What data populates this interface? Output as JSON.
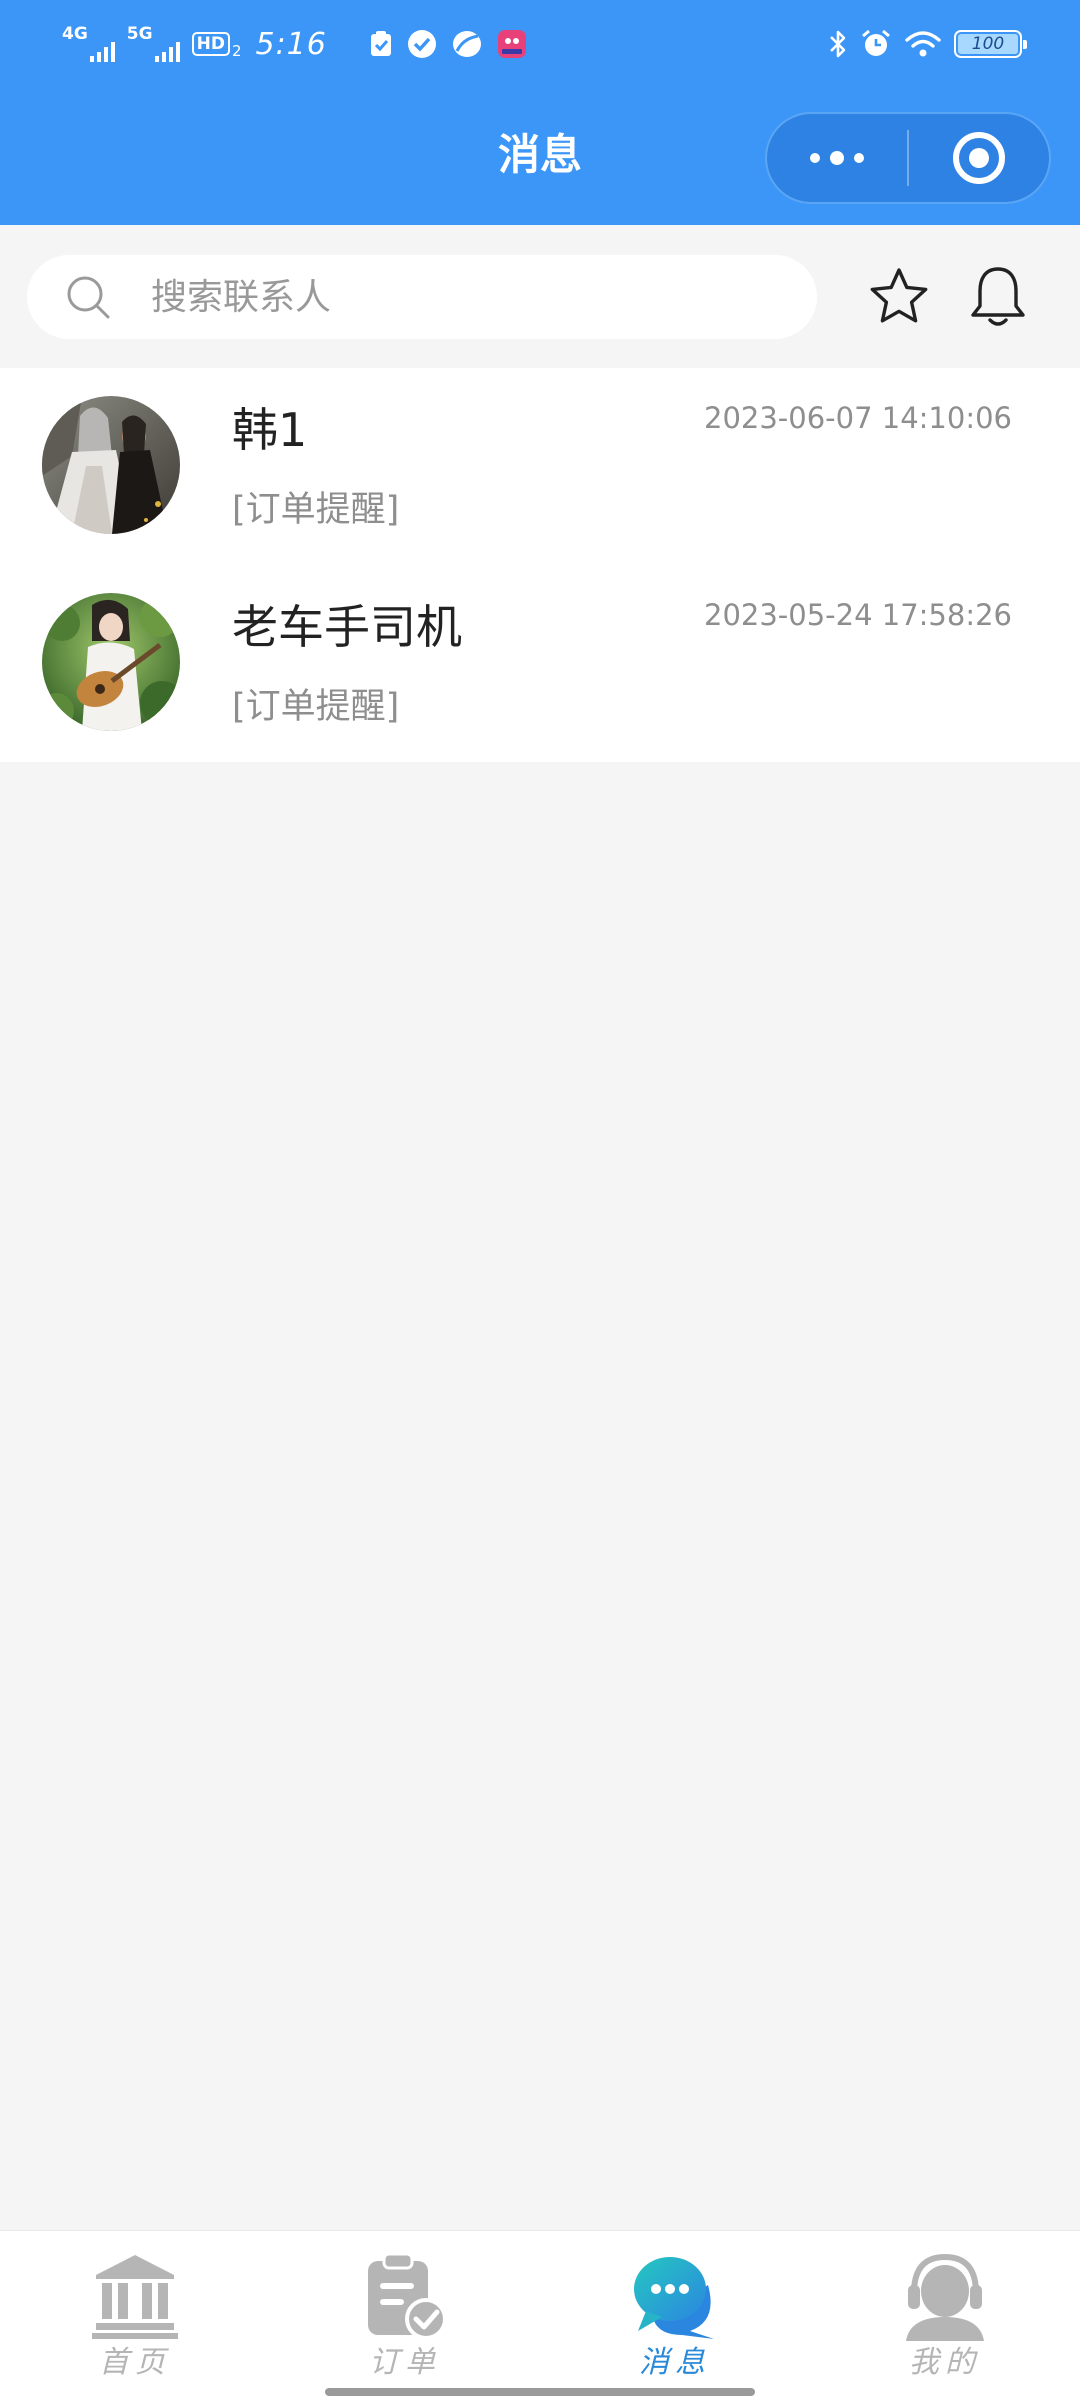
{
  "status_bar": {
    "network_1": "4G",
    "network_2": "5G",
    "hd_label": "HD",
    "hd_sub": "2",
    "time": "5:16",
    "battery_level": "100",
    "battery_fraction": 1.0
  },
  "header": {
    "title": "消息",
    "menu_icon": "more-dots-icon",
    "close_icon": "target-circle-icon",
    "background_color": "#3b96f7"
  },
  "search": {
    "placeholder": "搜索联系人",
    "value": "",
    "icon": "search-icon"
  },
  "actions": {
    "favorites_icon": "star-icon",
    "notifications_icon": "bell-icon"
  },
  "conversations": [
    {
      "name": "韩1",
      "time": "2023-06-07 14:10:06",
      "preview": "[订单提醒]",
      "avatar": "avatar-photo-two-figures"
    },
    {
      "name": "老车手司机",
      "time": "2023-05-24 17:58:26",
      "preview": "[订单提醒]",
      "avatar": "avatar-photo-guitar-girl"
    }
  ],
  "tabs": [
    {
      "label": "首页",
      "icon": "bank-building-icon",
      "active": false
    },
    {
      "label": "订单",
      "icon": "clipboard-check-icon",
      "active": false
    },
    {
      "label": "消息",
      "icon": "chat-bubble-icon",
      "active": true
    },
    {
      "label": "我的",
      "icon": "user-headset-icon",
      "active": false
    }
  ],
  "colors": {
    "accent": "#3b96f7",
    "tab_active": "#2b8ad8",
    "tab_inactive": "#b5b5b5",
    "chat_icon_gradient_start": "#25c8c0",
    "chat_icon_gradient_end": "#2b86e0"
  }
}
